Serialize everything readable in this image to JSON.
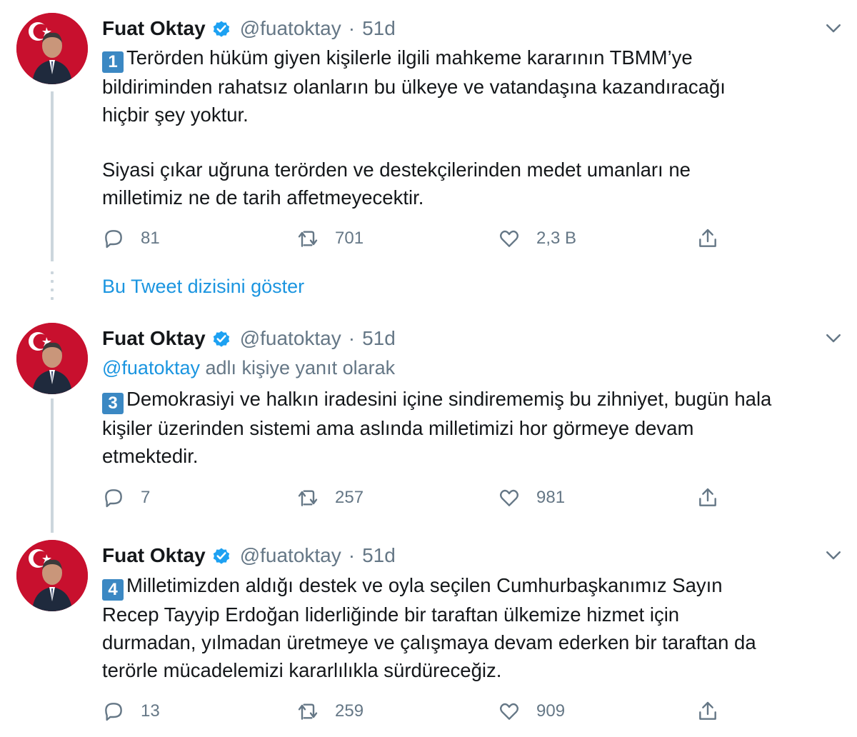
{
  "thread_link": "Bu Tweet dizisini göster",
  "colors": {
    "accent": "#1b95e0",
    "muted": "#657786",
    "text": "#14171a",
    "number_badge": "#3b88c3",
    "thread_line": "#ccd6dd"
  },
  "tweets": [
    {
      "author": "Fuat Oktay",
      "handle": "@fuatoktay",
      "dot": "·",
      "time": "51d",
      "badge": "1",
      "lines": [
        "Terörden hüküm giyen kişilerle ilgili mahkeme kararının TBMM’ye",
        "bildiriminden rahatsız olanların bu ülkeye ve vatandaşına kazandıracağı",
        "hiçbir şey yoktur."
      ],
      "lines2": [
        "Siyasi çıkar uğruna terörden ve destekçilerinden medet umanları ne",
        "milletimiz ne de tarih affetmeyecektir."
      ],
      "replies": "81",
      "retweets": "701",
      "likes": "2,3 B"
    },
    {
      "author": "Fuat Oktay",
      "handle": "@fuatoktay",
      "dot": "·",
      "time": "51d",
      "reply_mention": "@fuatoktay",
      "reply_suffix": " adlı kişiye yanıt olarak",
      "badge": "3",
      "lines": [
        "Demokrasiyi ve halkın iradesini içine sindirememiş bu zihniyet, bugün hala",
        "kişiler üzerinden sistemi ama aslında milletimizi hor görmeye devam",
        "etmektedir."
      ],
      "replies": "7",
      "retweets": "257",
      "likes": "981"
    },
    {
      "author": "Fuat Oktay",
      "handle": "@fuatoktay",
      "dot": "·",
      "time": "51d",
      "badge": "4",
      "lines": [
        "Milletimizden aldığı destek ve oyla seçilen Cumhurbaşkanımız Sayın",
        "Recep Tayyip Erdoğan liderliğinde bir taraftan ülkemize hizmet için",
        "durmadan, yılmadan üretmeye ve çalışmaya devam ederken bir taraftan da",
        "terörle mücadelemizi kararlılıkla sürdüreceğiz."
      ],
      "replies": "13",
      "retweets": "259",
      "likes": "909"
    }
  ],
  "icons": {
    "reply": "reply-icon",
    "retweet": "retweet-icon",
    "like": "heart-icon",
    "share": "share-icon",
    "verified": "verified-badge-icon",
    "caret": "chevron-down-icon"
  }
}
